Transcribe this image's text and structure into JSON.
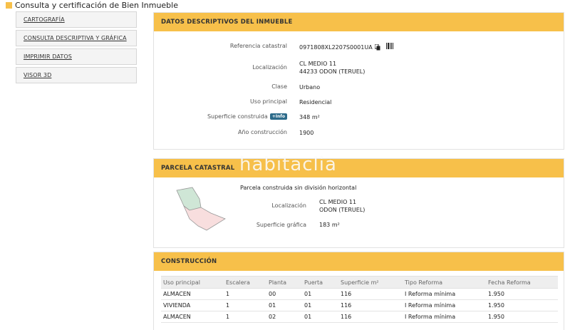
{
  "page": {
    "title": "Consulta y certificación de Bien Inmueble"
  },
  "nav": {
    "items": [
      {
        "label": "CARTOGRAFÍA"
      },
      {
        "label": "CONSULTA DESCRIPTIVA Y GRÁFICA"
      },
      {
        "label": "IMPRIMIR DATOS"
      },
      {
        "label": "VISOR 3D"
      }
    ]
  },
  "datos": {
    "header": "DATOS DESCRIPTIVOS DEL INMUEBLE",
    "ref_label": "Referencia catastral",
    "ref_value": "0971808XL2207S0001UA",
    "loc_label": "Localización",
    "loc_line1": "CL MEDIO 11",
    "loc_line2": "44233 ODON (TERUEL)",
    "clase_label": "Clase",
    "clase_value": "Urbano",
    "uso_label": "Uso principal",
    "uso_value": "Residencial",
    "sup_label": "Superficie construida",
    "info_badge": "+Info",
    "sup_value": "348 m²",
    "anio_label": "Año construcción",
    "anio_value": "1900"
  },
  "parcela": {
    "header": "PARCELA CATASTRAL",
    "desc": "Parcela construida sin división horizontal",
    "loc_label": "Localización",
    "loc_line1": "CL MEDIO 11",
    "loc_line2": "ODON (TERUEL)",
    "sup_label": "Superficie gráfica",
    "sup_value": "183 m²"
  },
  "watermark": "habitaclia",
  "construccion": {
    "header": "CONSTRUCCIÓN",
    "columns": [
      "Uso principal",
      "Escalera",
      "Planta",
      "Puerta",
      "Superficie m²",
      "Tipo Reforma",
      "Fecha Reforma"
    ],
    "rows": [
      [
        "ALMACEN",
        "1",
        "00",
        "01",
        "116",
        "I Reforma mínima",
        "1.950"
      ],
      [
        "VIVIENDA",
        "1",
        "01",
        "01",
        "116",
        "I Reforma mínima",
        "1.950"
      ],
      [
        "ALMACEN",
        "1",
        "02",
        "01",
        "116",
        "I Reforma mínima",
        "1.950"
      ]
    ]
  },
  "colors": {
    "accent": "#f7c04a",
    "badge": "#2d6b8a",
    "parcel_green": "#cfe6d6",
    "parcel_pink": "#f8dede"
  }
}
